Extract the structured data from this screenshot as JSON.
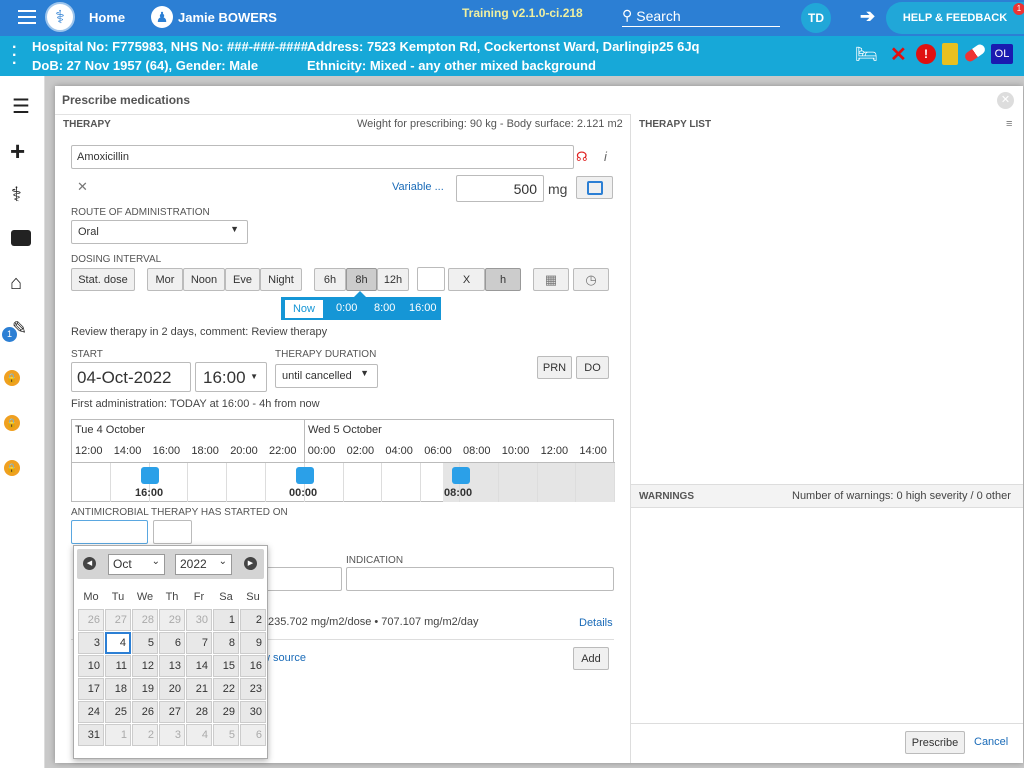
{
  "topbar": {
    "home": "Home",
    "patient_name": "Jamie BOWERS",
    "build": "Training v2.1.0-ci.218",
    "search": "Search",
    "avatar": "TD",
    "help": "HELP & FEEDBACK",
    "help_badge": "1"
  },
  "patient": {
    "line1_left": "Hospital No: F775983, NHS No: ###-###-####",
    "line2_left": "DoB: 27 Nov 1957 (64), Gender: Male",
    "line1_right": "Address: 7523 Kempton Rd, Cockertonst Ward, Darlingip25 6Jq",
    "line2_right": "Ethnicity: Mixed - any other mixed background",
    "ol": "OL"
  },
  "leftnav": {
    "badge": "1"
  },
  "dialog": {
    "title": "Prescribe medications",
    "therapy": "THERAPY",
    "weight": "Weight for prescribing: 90 kg - Body surface: 2.121 m2",
    "therapy_list": "THERAPY LIST",
    "warnings": "WARNINGS",
    "warnings_count": "Number of warnings: 0 high severity / 0 other"
  },
  "med": {
    "name": "Amoxicillin",
    "variable": "Variable ...",
    "dose": "500",
    "unit": "mg"
  },
  "route": {
    "label": "ROUTE OF ADMINISTRATION",
    "value": "Oral"
  },
  "dosing": {
    "label": "DOSING INTERVAL",
    "stat": "Stat. dose",
    "mor": "Mor",
    "noon": "Noon",
    "eve": "Eve",
    "night": "Night",
    "h6": "6h",
    "h8": "8h",
    "h12": "12h",
    "x": "X",
    "h": "h"
  },
  "times": {
    "now": "Now",
    "t1": "0:00",
    "t2": "8:00",
    "t3": "16:00"
  },
  "review": "Review therapy in 2 days, comment: Review therapy",
  "start": {
    "label": "START",
    "date": "04-Oct-2022",
    "time": "16:00",
    "dur_label": "THERAPY DURATION",
    "dur": "until cancelled",
    "prn": "PRN",
    "do": "DO"
  },
  "first_admin": "First administration: TODAY at 16:00 - 4h from now",
  "timeline": {
    "day1": "Tue 4 October",
    "day2": "Wed 5 October",
    "hours": [
      "12:00",
      "14:00",
      "16:00",
      "18:00",
      "20:00",
      "22:00",
      "00:00",
      "02:00",
      "04:00",
      "06:00",
      "08:00",
      "10:00",
      "12:00",
      "14:00"
    ],
    "d1": "16:00",
    "d2": "00:00",
    "d3": "08:00"
  },
  "antimicrobial": "ANTIMICROBIAL THERAPY HAS STARTED ON",
  "indication": "INDICATION",
  "dose_calc": "235.702 mg/m2/dose • 707.107 mg/m2/day",
  "details": "Details",
  "source": "w source",
  "add": "Add",
  "prescribe": "Prescribe",
  "cancel": "Cancel",
  "calendar": {
    "month": "Oct",
    "year": "2022",
    "days": [
      "Mo",
      "Tu",
      "We",
      "Th",
      "Fr",
      "Sa",
      "Su"
    ],
    "weeks": [
      [
        "26",
        "27",
        "28",
        "29",
        "30",
        "1",
        "2"
      ],
      [
        "3",
        "4",
        "5",
        "6",
        "7",
        "8",
        "9"
      ],
      [
        "10",
        "11",
        "12",
        "13",
        "14",
        "15",
        "16"
      ],
      [
        "17",
        "18",
        "19",
        "20",
        "21",
        "22",
        "23"
      ],
      [
        "24",
        "25",
        "26",
        "27",
        "28",
        "29",
        "30"
      ],
      [
        "31",
        "1",
        "2",
        "3",
        "4",
        "5",
        "6"
      ]
    ]
  }
}
